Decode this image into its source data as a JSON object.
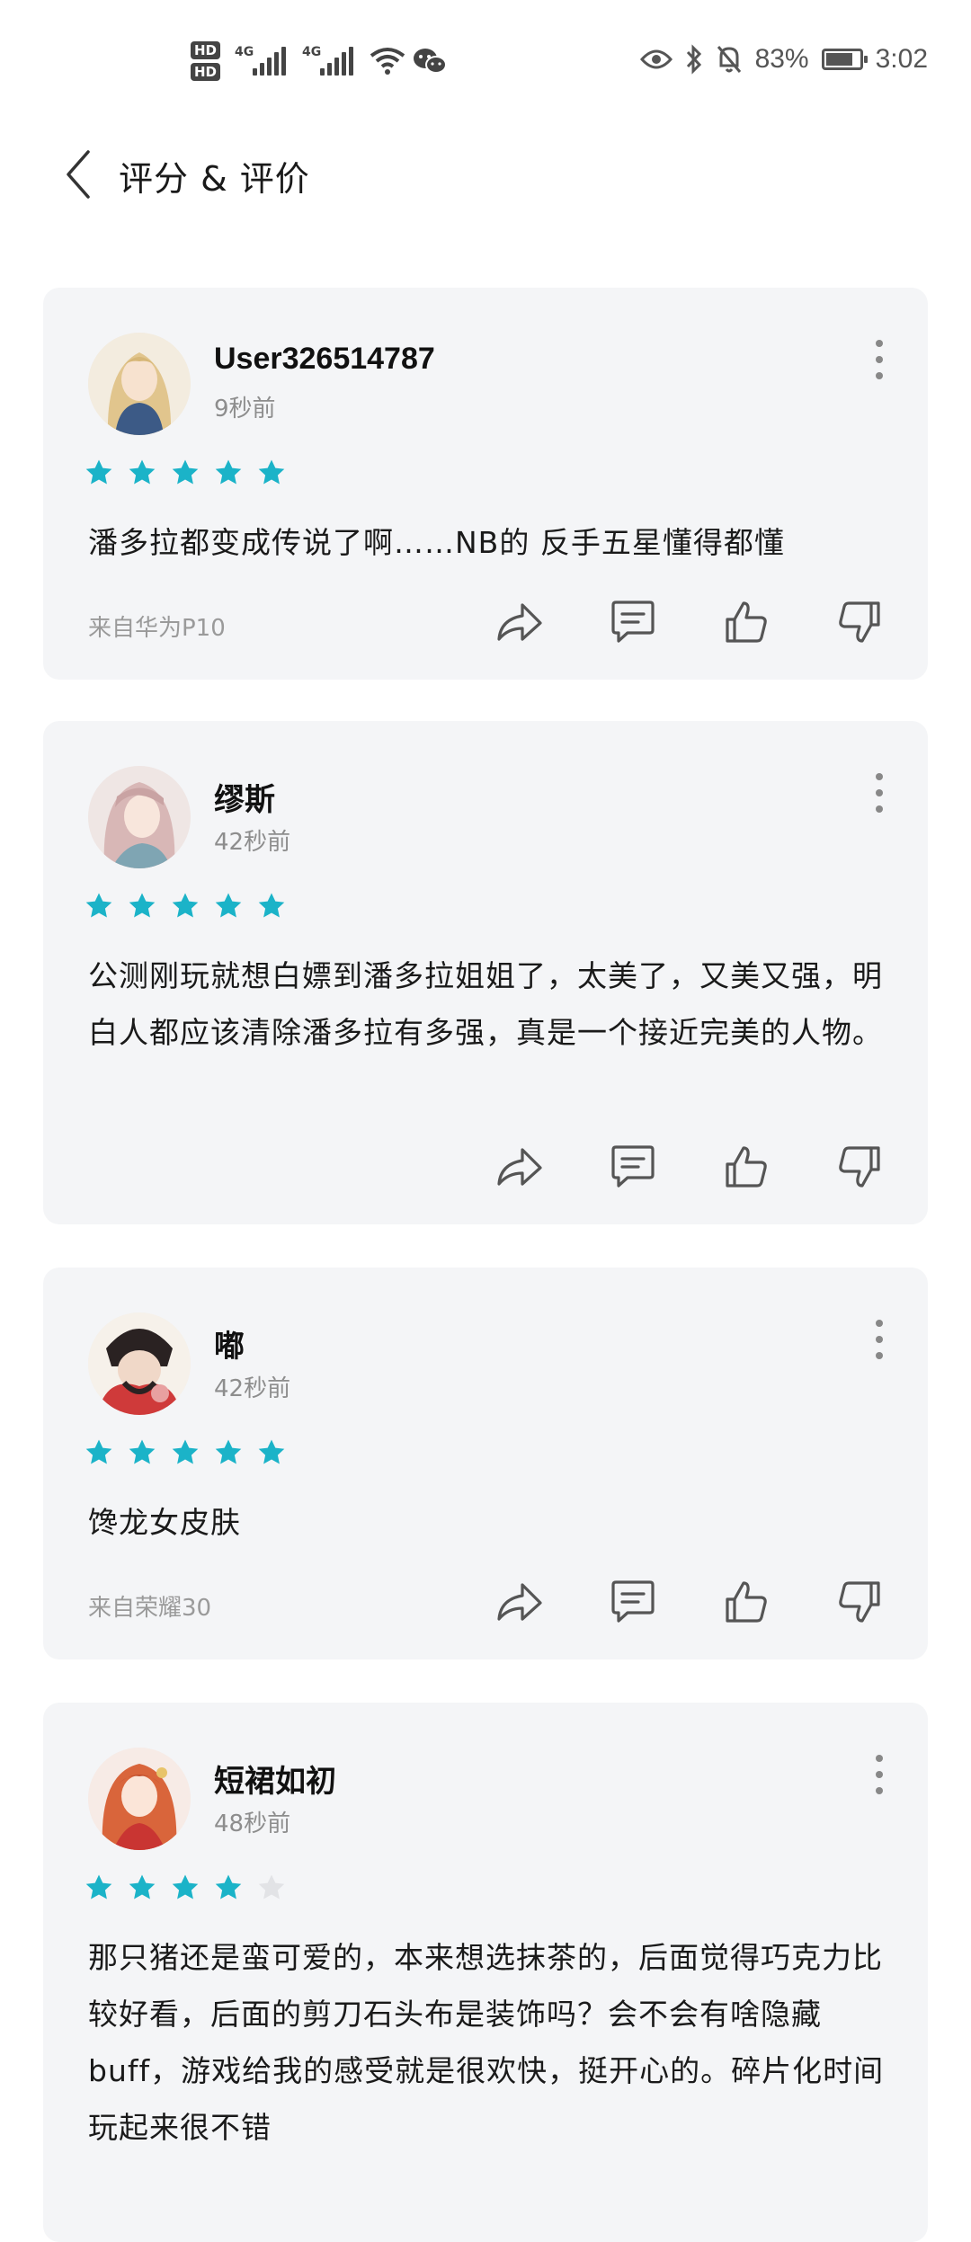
{
  "status_bar": {
    "hd1": "HD",
    "hd2": "HD",
    "net1": "4G",
    "net2": "4G",
    "battery_text": "83%",
    "battery_level": 0.83,
    "time": "3:02"
  },
  "header": {
    "title": "评分 & 评价"
  },
  "colors": {
    "star_filled": "#1bb3c8",
    "star_empty": "#e2e3e6",
    "card_bg": "#f4f5f7"
  },
  "reviews": [
    {
      "user": "User326514787",
      "time": "9秒前",
      "rating": 5,
      "content": "潘多拉都变成传说了啊……NB的 反手五星懂得都懂",
      "device": "来自华为P10"
    },
    {
      "user": "缪斯",
      "time": "42秒前",
      "rating": 5,
      "content": "公测刚玩就想白嫖到潘多拉姐姐了，太美了，又美又强，明白人都应该清除潘多拉有多强，真是一个接近完美的人物。",
      "device": ""
    },
    {
      "user": "嘟",
      "time": "42秒前",
      "rating": 5,
      "content": "馋龙女皮肤",
      "device": "来自荣耀30"
    },
    {
      "user": "短裙如初",
      "time": "48秒前",
      "rating": 4,
      "content": "那只猪还是蛮可爱的，本来想选抹茶的，后面觉得巧克力比较好看，后面的剪刀石头布是装饰吗？会不会有啥隐藏buff，游戏给我的感受就是很欢快，挺开心的。碎片化时间玩起来很不错",
      "device": ""
    }
  ]
}
